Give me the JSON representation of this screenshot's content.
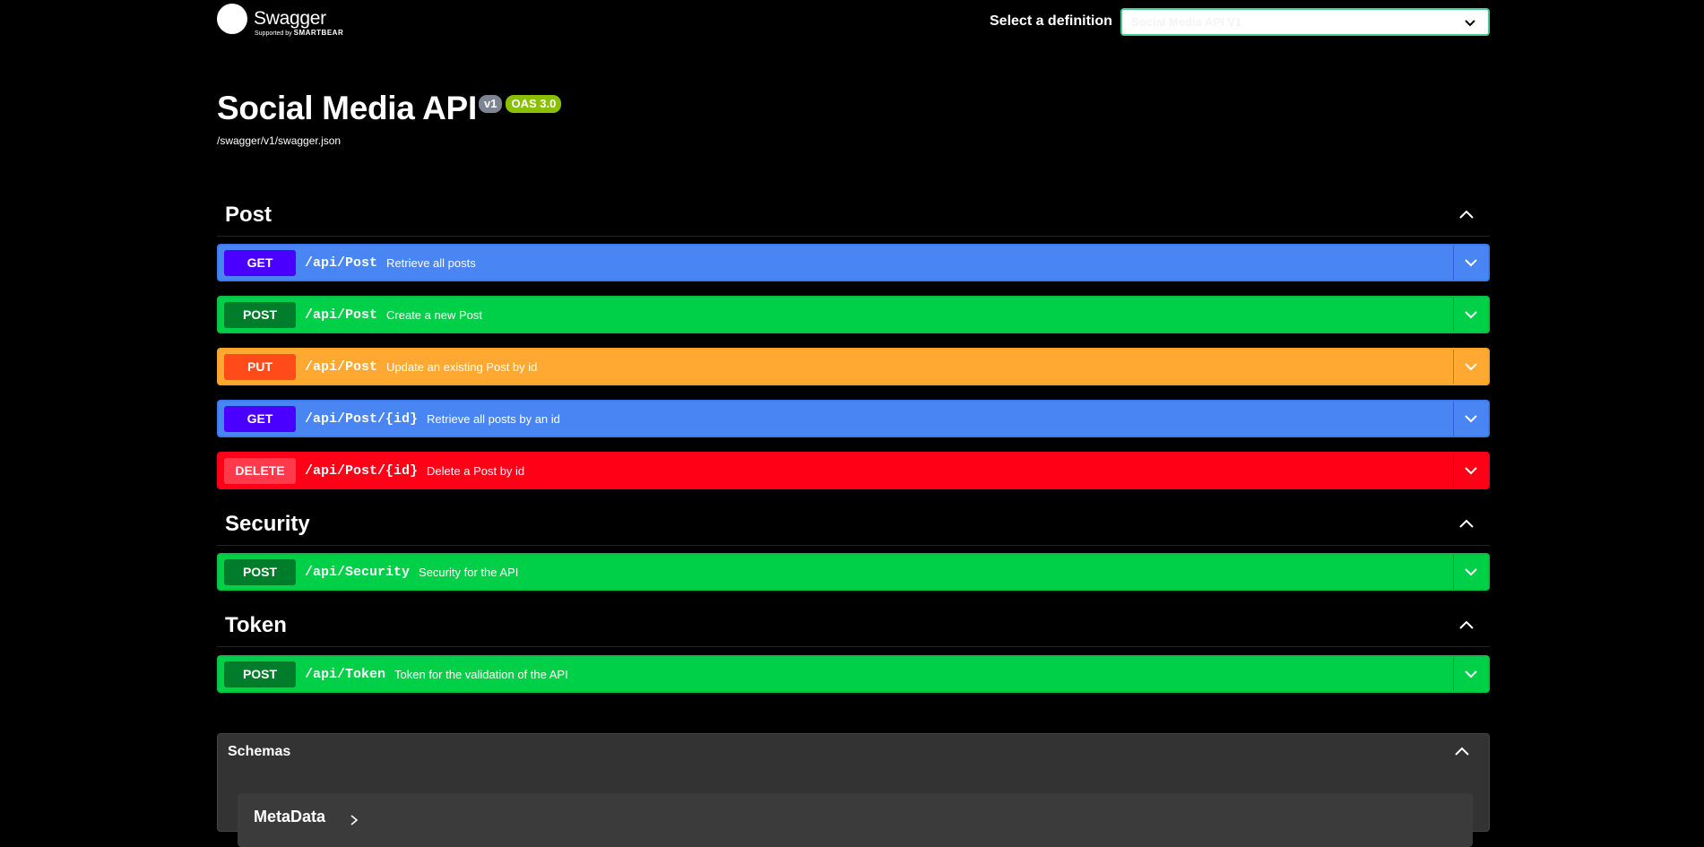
{
  "header": {
    "logo_name": "Swagger",
    "logo_sub_prefix": "Supported by",
    "logo_sub_brand": "SMARTBEAR",
    "definition_label": "Select a definition",
    "definition_selected": "Social Media API V1"
  },
  "info": {
    "title": "Social Media API",
    "version_badge": "v1",
    "oas_badge": "OAS 3.0",
    "spec_url": "/swagger/v1/swagger.json"
  },
  "tags": [
    {
      "name": "Post",
      "operations": [
        {
          "method": "GET",
          "path": "/api/Post",
          "summary": "Retrieve all posts"
        },
        {
          "method": "POST",
          "path": "/api/Post",
          "summary": "Create a new Post"
        },
        {
          "method": "PUT",
          "path": "/api/Post",
          "summary": "Update an existing Post by id"
        },
        {
          "method": "GET",
          "path": "/api/Post/{id}",
          "summary": "Retrieve all posts by an id"
        },
        {
          "method": "DELETE",
          "path": "/api/Post/{id}",
          "summary": "Delete a Post by id"
        }
      ]
    },
    {
      "name": "Security",
      "operations": [
        {
          "method": "POST",
          "path": "/api/Security",
          "summary": "Security for the API"
        }
      ]
    },
    {
      "name": "Token",
      "operations": [
        {
          "method": "POST",
          "path": "/api/Token",
          "summary": "Token for the validation of the API"
        }
      ]
    }
  ],
  "schemas": {
    "title": "Schemas",
    "items": [
      "MetaData"
    ]
  },
  "colors": {
    "background": "#000000",
    "get": "#4a86f3",
    "post": "#00d047",
    "put": "#ffa832",
    "delete": "#ff0016"
  },
  "icons": {
    "tag_toggle": "chevron-up-icon",
    "op_toggle": "chevron-down-icon",
    "select_caret": "chevron-down-icon"
  }
}
